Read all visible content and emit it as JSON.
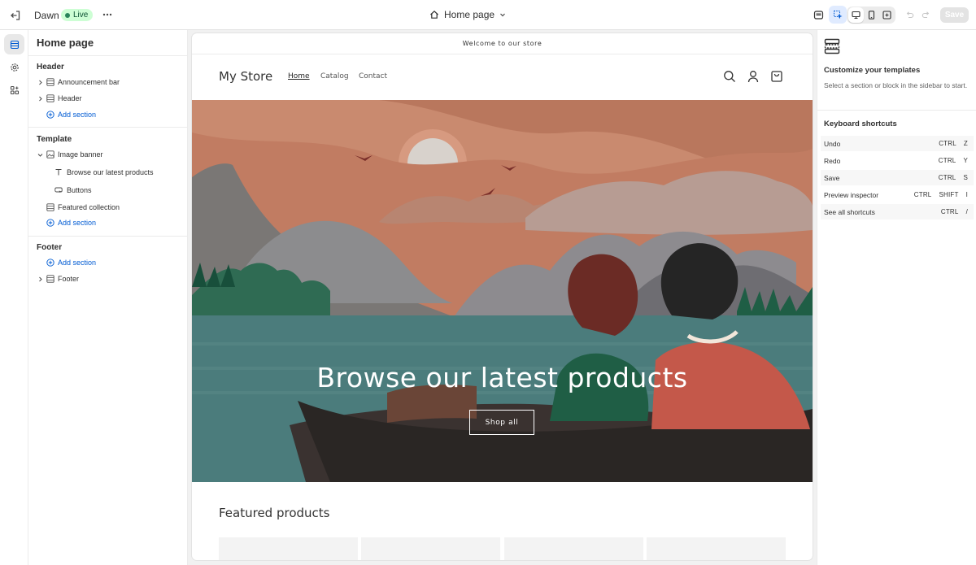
{
  "topbar": {
    "theme_name": "Dawn",
    "live_label": "Live",
    "page_picker_label": "Home page",
    "save_label": "Save"
  },
  "sidebar": {
    "title": "Home page",
    "groups": {
      "header": {
        "title": "Header",
        "items": [
          "Announcement bar",
          "Header"
        ],
        "add_label": "Add section"
      },
      "template": {
        "title": "Template",
        "items": {
          "image_banner": "Image banner",
          "heading_block": "Browse our latest products",
          "buttons_block": "Buttons",
          "featured_collection": "Featured collection"
        },
        "add_label": "Add section"
      },
      "footer": {
        "title": "Footer",
        "add_label": "Add section",
        "items": [
          "Footer"
        ]
      }
    }
  },
  "preview": {
    "announcement": "Welcome to our store",
    "store_name": "My Store",
    "nav": [
      "Home",
      "Catalog",
      "Contact"
    ],
    "banner_heading": "Browse our latest products",
    "banner_button": "Shop all",
    "featured_heading": "Featured products"
  },
  "right_panel": {
    "title": "Customize your templates",
    "description": "Select a section or block in the sidebar to start.",
    "shortcuts_title": "Keyboard shortcuts",
    "shortcuts": [
      {
        "label": "Undo",
        "keys": [
          "CTRL",
          "Z"
        ]
      },
      {
        "label": "Redo",
        "keys": [
          "CTRL",
          "Y"
        ]
      },
      {
        "label": "Save",
        "keys": [
          "CTRL",
          "S"
        ]
      },
      {
        "label": "Preview inspector",
        "keys": [
          "CTRL",
          "SHIFT",
          "I"
        ]
      },
      {
        "label": "See all shortcuts",
        "keys": [
          "CTRL",
          "/"
        ]
      }
    ]
  },
  "colors": {
    "accent_blue": "#005bd3",
    "live_green": "#29845a",
    "banner_sky": "#c98a6f",
    "banner_water": "#4b7c7c"
  },
  "icons": {
    "rail": [
      "sections-icon",
      "settings-gear-icon",
      "apps-icon"
    ],
    "topbar": [
      "exit-icon",
      "more-icon",
      "home-icon",
      "chevron-down-icon",
      "inspector-icon",
      "select-cursor-icon",
      "desktop-icon",
      "mobile-icon",
      "fullscreen-icon",
      "undo-icon",
      "redo-icon"
    ]
  }
}
